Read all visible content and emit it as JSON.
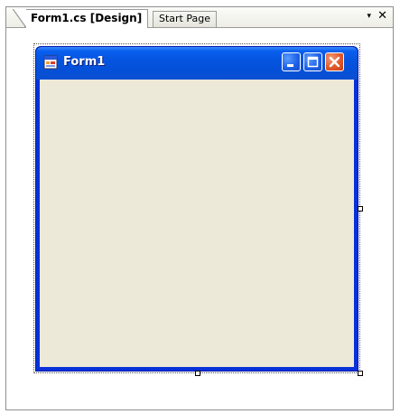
{
  "tabs": [
    {
      "label": "Form1.cs [Design]",
      "active": true
    },
    {
      "label": "Start Page",
      "active": false
    }
  ],
  "tab_controls": {
    "dropdown_icon": "chevron-down-icon",
    "close_icon": "close-icon",
    "dropdown_glyph": "▾",
    "close_glyph": "✕"
  },
  "form": {
    "title": "Form1",
    "icon": "form-app-icon",
    "client_color": "#ece9d8",
    "titlebar_color": "#0554e0",
    "caption_buttons": [
      {
        "name": "minimize",
        "icon": "minimize-icon"
      },
      {
        "name": "maximize",
        "icon": "maximize-icon"
      },
      {
        "name": "close",
        "icon": "close-icon",
        "color": "#e05a2a"
      }
    ]
  }
}
